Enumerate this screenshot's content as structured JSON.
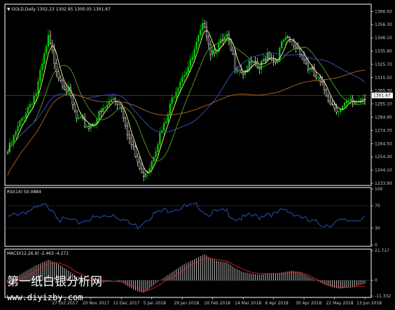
{
  "chart_data": [
    {
      "type": "candlestick",
      "header": "▼ GOLD,Daily  1302.23 1302.95 1300.05 1301.67",
      "symbol": "GOLD,Daily",
      "last_price": "1301.67",
      "ylim": [
        1233.9,
        1371.0
      ],
      "y_ticks": [
        "1366.50",
        "1356.30",
        "1346.10",
        "1335.90",
        "1325.70",
        "1315.50",
        "1305.30",
        "1295.10",
        "1284.90",
        "1274.70",
        "1264.50",
        "1254.30",
        "1244.10",
        "1233.90"
      ],
      "x_ticks": [
        "27 Oct 2017",
        "20 Nov 2017",
        "12 Dec 2017",
        "5 Jan 2018",
        "29 Jan 2018",
        "20 Feb 2018",
        "14 Mar 2018",
        "6 Apr 2018",
        "30 Apr 2018",
        "22 May 2018",
        "13 Jun 2018"
      ],
      "key_points": [
        [
          0,
          1258
        ],
        [
          8,
          1287
        ],
        [
          14,
          1304
        ],
        [
          20,
          1345
        ],
        [
          25,
          1318
        ],
        [
          30,
          1304
        ],
        [
          34,
          1283
        ],
        [
          40,
          1278
        ],
        [
          46,
          1288
        ],
        [
          52,
          1300
        ],
        [
          56,
          1294
        ],
        [
          60,
          1268
        ],
        [
          64,
          1250
        ],
        [
          66,
          1240
        ],
        [
          70,
          1248
        ],
        [
          74,
          1267
        ],
        [
          78,
          1281
        ],
        [
          82,
          1304
        ],
        [
          86,
          1318
        ],
        [
          90,
          1326
        ],
        [
          94,
          1345
        ],
        [
          97,
          1358
        ],
        [
          100,
          1336
        ],
        [
          104,
          1340
        ],
        [
          108,
          1346
        ],
        [
          112,
          1326
        ],
        [
          116,
          1320
        ],
        [
          120,
          1326
        ],
        [
          124,
          1322
        ],
        [
          128,
          1335
        ],
        [
          132,
          1328
        ],
        [
          136,
          1344
        ],
        [
          140,
          1342
        ],
        [
          144,
          1337
        ],
        [
          148,
          1323
        ],
        [
          152,
          1315
        ],
        [
          156,
          1306
        ],
        [
          160,
          1295
        ],
        [
          164,
          1290
        ],
        [
          168,
          1296
        ],
        [
          172,
          1297
        ],
        [
          176,
          1301.67
        ]
      ],
      "moving_averages": [
        "fast",
        "medium",
        "slow",
        "very-slow"
      ],
      "colors": {
        "bull": "#00cc00",
        "bear": "#ffffff",
        "ma_fast": "#ffff99",
        "ma_medium": "#5c9e2a",
        "ma_slow": "#3355cc",
        "ma_very_slow": "#b5651d"
      }
    },
    {
      "type": "line",
      "header": "RSI(14) 50.0884",
      "ylim": [
        0,
        100
      ],
      "y_ticks": [
        "100",
        "70",
        "30",
        "0"
      ],
      "levels": [
        70,
        30
      ],
      "key_points": [
        [
          0,
          48
        ],
        [
          6,
          58
        ],
        [
          12,
          62
        ],
        [
          18,
          70
        ],
        [
          22,
          66
        ],
        [
          26,
          44
        ],
        [
          30,
          45
        ],
        [
          34,
          39
        ],
        [
          40,
          47
        ],
        [
          46,
          49
        ],
        [
          52,
          55
        ],
        [
          56,
          48
        ],
        [
          60,
          38
        ],
        [
          64,
          33
        ],
        [
          68,
          46
        ],
        [
          72,
          55
        ],
        [
          76,
          60
        ],
        [
          80,
          64
        ],
        [
          84,
          66
        ],
        [
          88,
          68
        ],
        [
          94,
          70
        ],
        [
          98,
          56
        ],
        [
          102,
          58
        ],
        [
          108,
          60
        ],
        [
          112,
          47
        ],
        [
          116,
          48
        ],
        [
          120,
          52
        ],
        [
          124,
          50
        ],
        [
          128,
          58
        ],
        [
          132,
          54
        ],
        [
          136,
          62
        ],
        [
          140,
          58
        ],
        [
          144,
          52
        ],
        [
          148,
          42
        ],
        [
          152,
          40
        ],
        [
          156,
          36
        ],
        [
          160,
          38
        ],
        [
          164,
          42
        ],
        [
          168,
          44
        ],
        [
          172,
          46
        ],
        [
          176,
          50.09
        ]
      ],
      "color": "#3355cc"
    },
    {
      "type": "bar",
      "header": "MACD(12,26,9) -2.463 -4.271",
      "ylim": [
        -11.332,
        21.717
      ],
      "y_ticks": [
        "21.717",
        "0",
        "-11.332"
      ],
      "histogram_points": [
        [
          0,
          -2
        ],
        [
          8,
          6
        ],
        [
          14,
          11
        ],
        [
          20,
          15
        ],
        [
          25,
          12
        ],
        [
          30,
          7
        ],
        [
          34,
          3
        ],
        [
          40,
          0
        ],
        [
          46,
          -2
        ],
        [
          52,
          0
        ],
        [
          56,
          -1
        ],
        [
          60,
          -5
        ],
        [
          64,
          -8
        ],
        [
          67,
          -9
        ],
        [
          70,
          -6
        ],
        [
          74,
          -1
        ],
        [
          78,
          3
        ],
        [
          82,
          7
        ],
        [
          86,
          11
        ],
        [
          90,
          14
        ],
        [
          94,
          17
        ],
        [
          97,
          19
        ],
        [
          100,
          16
        ],
        [
          104,
          14
        ],
        [
          108,
          13
        ],
        [
          112,
          9
        ],
        [
          116,
          6
        ],
        [
          120,
          5
        ],
        [
          124,
          4
        ],
        [
          128,
          5
        ],
        [
          132,
          5
        ],
        [
          136,
          6
        ],
        [
          140,
          7
        ],
        [
          144,
          6
        ],
        [
          148,
          3
        ],
        [
          152,
          0
        ],
        [
          156,
          -3
        ],
        [
          160,
          -5
        ],
        [
          164,
          -6
        ],
        [
          168,
          -5
        ],
        [
          172,
          -4
        ],
        [
          176,
          -2.46
        ]
      ],
      "signal_points": [
        [
          0,
          -3
        ],
        [
          8,
          2
        ],
        [
          14,
          7
        ],
        [
          20,
          12
        ],
        [
          25,
          13
        ],
        [
          30,
          10
        ],
        [
          34,
          6
        ],
        [
          40,
          2
        ],
        [
          46,
          0
        ],
        [
          52,
          -1
        ],
        [
          56,
          -1
        ],
        [
          60,
          -3
        ],
        [
          64,
          -6
        ],
        [
          67,
          -8
        ],
        [
          70,
          -7
        ],
        [
          74,
          -4
        ],
        [
          78,
          0
        ],
        [
          82,
          3
        ],
        [
          86,
          7
        ],
        [
          90,
          11
        ],
        [
          94,
          14
        ],
        [
          97,
          16
        ],
        [
          100,
          16
        ],
        [
          104,
          15
        ],
        [
          108,
          14
        ],
        [
          112,
          11
        ],
        [
          116,
          8
        ],
        [
          120,
          6
        ],
        [
          124,
          5
        ],
        [
          128,
          5
        ],
        [
          132,
          5
        ],
        [
          136,
          5
        ],
        [
          140,
          6
        ],
        [
          144,
          6
        ],
        [
          148,
          4
        ],
        [
          152,
          1
        ],
        [
          156,
          -2
        ],
        [
          160,
          -4
        ],
        [
          164,
          -5
        ],
        [
          168,
          -5
        ],
        [
          172,
          -4.5
        ],
        [
          176,
          -4.27
        ]
      ],
      "colors": {
        "histogram": "#c8c8c8",
        "signal": "#e02020"
      }
    }
  ],
  "watermark": {
    "line1": "第一纸白银分析网",
    "line2": "www.diyizby.com"
  },
  "colors": {
    "background": "#000000",
    "frame": "#ffffff",
    "axis_text": "#c8c8c8",
    "level_line": "#808080"
  }
}
